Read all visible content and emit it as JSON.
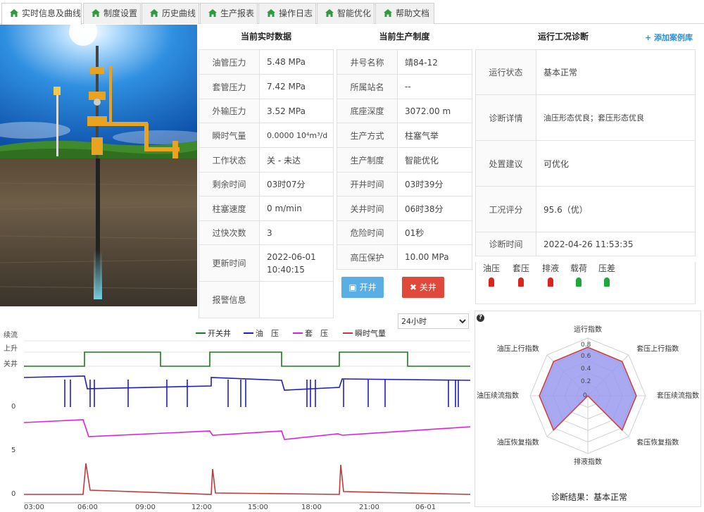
{
  "tabs": [
    {
      "label": "实时信息及曲线",
      "active": true
    },
    {
      "label": "制度设置"
    },
    {
      "label": "历史曲线"
    },
    {
      "label": "生产报表"
    },
    {
      "label": "操作日志"
    },
    {
      "label": "智能优化"
    },
    {
      "label": "帮助文档"
    }
  ],
  "realtime": {
    "title": "当前实时数据",
    "rows": [
      {
        "k": "油管压力",
        "v": "5.48 MPa"
      },
      {
        "k": "套管压力",
        "v": "7.42 MPa"
      },
      {
        "k": "外输压力",
        "v": "3.52 MPa"
      },
      {
        "k": "瞬时气量",
        "v": "0.0000 10⁴m³/d"
      },
      {
        "k": "工作状态",
        "v": "关 - 未达"
      },
      {
        "k": "剩余时间",
        "v": "03时07分"
      },
      {
        "k": "柱塞速度",
        "v": "0 m/min"
      },
      {
        "k": "过快次数",
        "v": "3"
      },
      {
        "k": "更新时间",
        "v": "2022-06-01 10:40:15"
      },
      {
        "k": "报警信息",
        "v": ""
      }
    ]
  },
  "system": {
    "title": "当前生产制度",
    "rows": [
      {
        "k": "井号名称",
        "v": "靖84-12"
      },
      {
        "k": "所属站名",
        "v": "--"
      },
      {
        "k": "底座深度",
        "v": "3072.00 m"
      },
      {
        "k": "生产方式",
        "v": "柱塞气举"
      },
      {
        "k": "生产制度",
        "v": "智能优化"
      },
      {
        "k": "开井时间",
        "v": "03时39分"
      },
      {
        "k": "关井时间",
        "v": "06时38分"
      },
      {
        "k": "危险时间",
        "v": "01秒"
      },
      {
        "k": "高压保护",
        "v": "10.00 MPa"
      }
    ],
    "open_btn": "开井",
    "close_btn": "关井"
  },
  "diagnosis": {
    "title": "运行工况诊断",
    "add_case": "+ 添加案例库",
    "rows": [
      {
        "k": "运行状态",
        "v": "基本正常"
      },
      {
        "k": "诊断详情",
        "v": "油压形态优良；套压形态优良"
      },
      {
        "k": "处置建议",
        "v": "可优化"
      },
      {
        "k": "工况评分",
        "v": "95.6（优）"
      },
      {
        "k": "诊断时间",
        "v": "2022-04-26 11:53:35"
      }
    ],
    "leds": [
      {
        "label": "油压",
        "color": "#d9251c"
      },
      {
        "label": "套压",
        "color": "#d9251c"
      },
      {
        "label": "排液",
        "color": "#d9251c"
      },
      {
        "label": "载荷",
        "color": "#1fa83a"
      },
      {
        "label": "压差",
        "color": "#1fa83a"
      }
    ]
  },
  "range_select": {
    "value": "24小时"
  },
  "trend": {
    "legend": [
      "开关井",
      "油　压",
      "套　压",
      "瞬时气量"
    ],
    "colors": [
      "#1b7a1b",
      "#1d1dc9",
      "#e020e0",
      "#c0393b"
    ],
    "y_state_labels": [
      "续流",
      "上升",
      "关井"
    ],
    "y_ticks": [
      "0",
      "5",
      "0"
    ],
    "x_ticks": [
      "03:00",
      "06:00",
      "09:00",
      "12:00",
      "15:00",
      "18:00",
      "21:00",
      "06-01"
    ]
  },
  "radar": {
    "help": "?",
    "axes": [
      "运行指数",
      "套压上行指数",
      "套压续流指数",
      "套压恢复指数",
      "排液指数",
      "油压恢复指数",
      "油压续流指数",
      "油压上行指数"
    ],
    "values": [
      0.84,
      0.84,
      0.84,
      0.84,
      0.0,
      0.84,
      0.84,
      0.84
    ],
    "scale_labels": [
      "0.8",
      "0.6",
      "0.4",
      "0.2",
      "0"
    ],
    "result": "诊断结果：基本正常",
    "fill": "#9a9af0",
    "stroke": "#d13a3a"
  }
}
